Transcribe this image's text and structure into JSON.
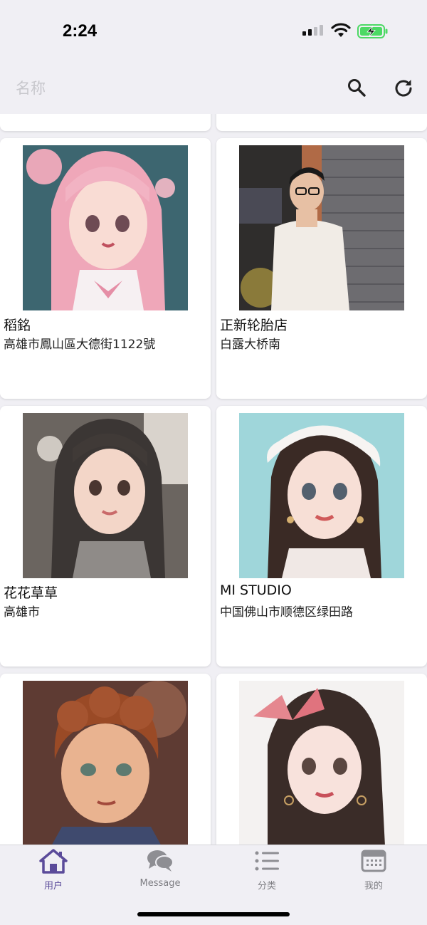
{
  "status_bar": {
    "time": "2:24"
  },
  "app_bar": {
    "search_placeholder": "名称",
    "search_icon": "search-icon",
    "refresh_icon": "refresh-icon"
  },
  "cards": [
    {
      "name": "稻銘",
      "address": "高雄市鳳山區大德街1122號",
      "image": "anime-girl-pink-hair"
    },
    {
      "name": "正新轮胎店",
      "address": "白露大桥南",
      "image": "young-man-white-tshirt"
    },
    {
      "name": "花花草草",
      "address": "高雄市",
      "image": "anime-girl-dark-hair"
    },
    {
      "name": "MI STUDIO",
      "address": "中国佛山市顺德区绿田路",
      "image": "anime-girl-maid-headband"
    },
    {
      "name": "",
      "address": "",
      "image": "cartoon-boy-curly-hair"
    },
    {
      "name": "",
      "address": "",
      "image": "anime-girl-pink-bow"
    }
  ],
  "tabs": [
    {
      "label": "用户",
      "icon": "home-icon",
      "active": true
    },
    {
      "label": "Message",
      "icon": "chat-icon",
      "active": false
    },
    {
      "label": "分类",
      "icon": "list-icon",
      "active": false
    },
    {
      "label": "我的",
      "icon": "calendar-icon",
      "active": false
    }
  ],
  "colors": {
    "accent": "#5b4b9a",
    "background": "#f0eff4",
    "inactive_tab": "#7d7d82"
  }
}
